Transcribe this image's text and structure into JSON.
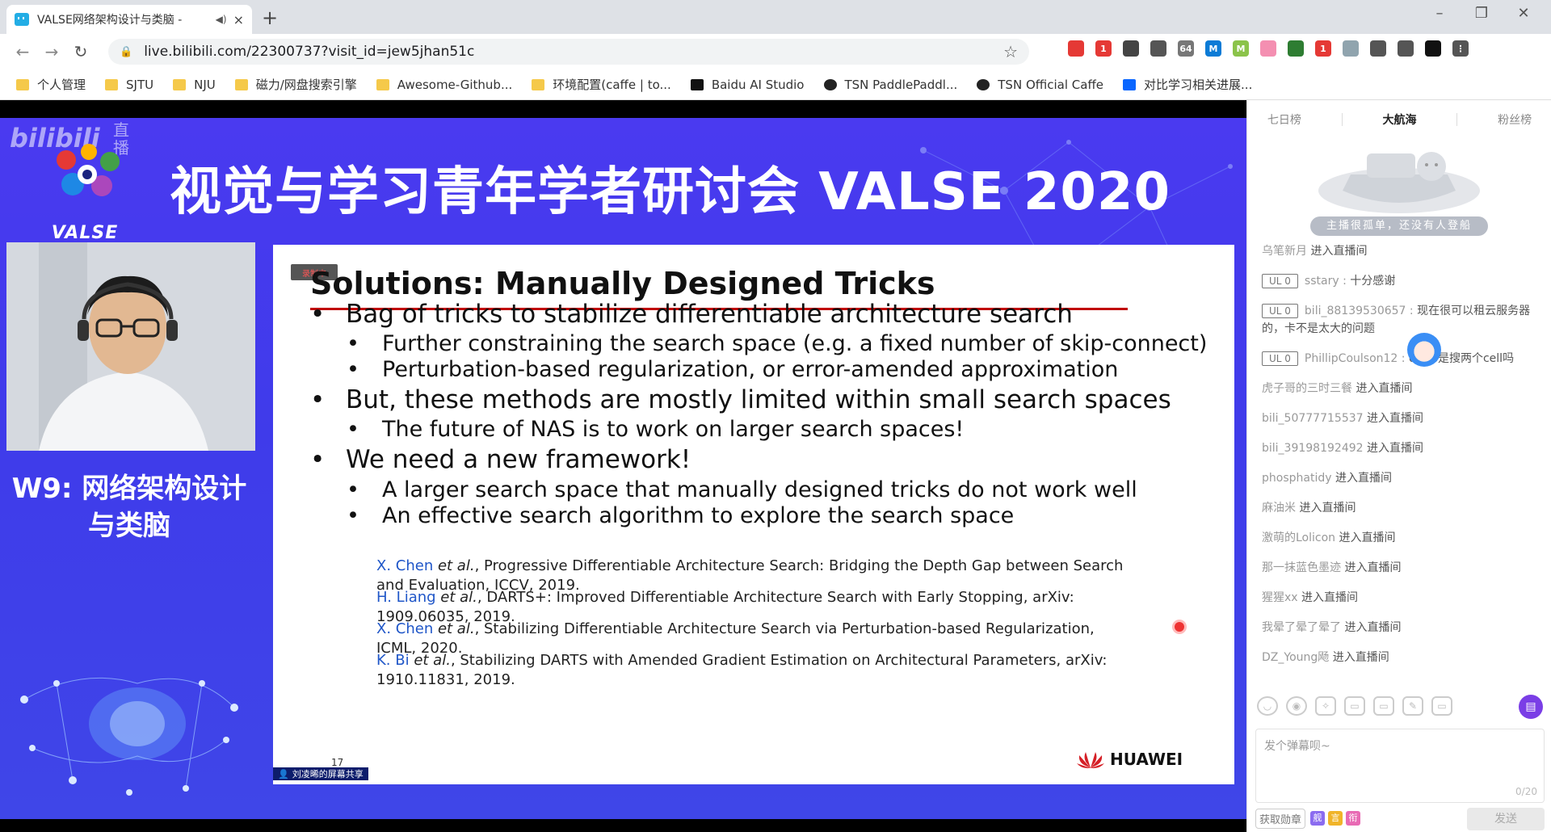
{
  "browser": {
    "tab_title": "VALSE网络架构设计与类脑 -",
    "tab_close": "×",
    "new_tab": "+",
    "url": "live.bilibili.com/22300737?visit_id=jew5jhan51c",
    "window_controls": {
      "minimize": "–",
      "maximize": "❐",
      "close": "✕"
    },
    "extensions": [
      {
        "name": "bili-ext-icon",
        "color": "#e53935",
        "label": ""
      },
      {
        "name": "ext-red-badge-icon",
        "color": "#e53935",
        "label": "1"
      },
      {
        "name": "download-icon",
        "color": "#444444",
        "label": ""
      },
      {
        "name": "code-icon",
        "color": "#555555",
        "label": ""
      },
      {
        "name": "base64-icon",
        "color": "#777777",
        "label": "64"
      },
      {
        "name": "m-blue-icon",
        "color": "#0b7bd6",
        "label": "M"
      },
      {
        "name": "m-green-icon",
        "color": "#8bc34a",
        "label": "M"
      },
      {
        "name": "pink-ext-icon",
        "color": "#f48fb1",
        "label": ""
      },
      {
        "name": "color-picker-icon",
        "color": "#2e7d32",
        "label": ""
      },
      {
        "name": "y-ext-icon",
        "color": "#e53935",
        "label": "1"
      },
      {
        "name": "bird-icon",
        "color": "#90a4ae",
        "label": ""
      },
      {
        "name": "puzzle-icon",
        "color": "#555555",
        "label": ""
      },
      {
        "name": "playlist-icon",
        "color": "#555555",
        "label": ""
      },
      {
        "name": "profile-avatar-icon",
        "color": "#111111",
        "label": ""
      },
      {
        "name": "menu-dots-icon",
        "color": "#555555",
        "label": "⋮"
      }
    ],
    "bookmarks": [
      {
        "label": "个人管理",
        "icon": "folder"
      },
      {
        "label": "SJTU",
        "icon": "folder"
      },
      {
        "label": "NJU",
        "icon": "folder"
      },
      {
        "label": "磁力/网盘搜索引擎",
        "icon": "folder"
      },
      {
        "label": "Awesome-Github...",
        "icon": "folder"
      },
      {
        "label": "环境配置(caffe | to...",
        "icon": "folder"
      },
      {
        "label": "Baidu AI Studio",
        "icon": "ai"
      },
      {
        "label": "TSN PaddlePaddl...",
        "icon": "gh"
      },
      {
        "label": "TSN Official Caffe",
        "icon": "gh"
      },
      {
        "label": "对比学习相关进展...",
        "icon": "zh"
      }
    ]
  },
  "stream": {
    "live_watermark": "bilibili",
    "live_watermark_side": "直播",
    "headline": "视觉与学习青年学者研讨会 VALSE 2020",
    "logo_text": "VALSE",
    "session_title_line1": "W9: 网络架构设计",
    "session_title_line2": "与类脑",
    "share_label": "刘凌晞的屏幕共享",
    "slide": {
      "recording_badge": "录制中",
      "title": "Solutions: Manually Designed Tricks",
      "bullets": [
        {
          "level": 1,
          "text": "Bag of tricks to stabilize differentiable architecture search"
        },
        {
          "level": 2,
          "text": "Further constraining the search space (e.g. a fixed number of skip-connect)"
        },
        {
          "level": 2,
          "text": "Perturbation-based regularization, or error-amended approximation"
        },
        {
          "level": 1,
          "text": "But, these methods are mostly limited within small search spaces"
        },
        {
          "level": 2,
          "text": "The future of NAS is to work on larger search spaces!"
        },
        {
          "level": 1,
          "text": "We need a new framework!"
        },
        {
          "level": 2,
          "text": "A larger search space that manually designed tricks do not work well"
        },
        {
          "level": 2,
          "text": "An effective search algorithm to explore the search space"
        }
      ],
      "references": [
        {
          "author": "X. Chen",
          "etal": " et al.",
          "line1": ", Progressive Differentiable Architecture Search: Bridging the Depth Gap between Search",
          "line2": "and Evaluation, ICCV, 2019."
        },
        {
          "author": "H. Liang",
          "etal": " et al.",
          "line1": ", DARTS+: Improved Differentiable Architecture Search with Early Stopping, arXiv:",
          "line2": "1909.06035, 2019."
        },
        {
          "author": "X. Chen",
          "etal": " et al.",
          "line1": ", Stabilizing Differentiable Architecture Search via Perturbation-based Regularization,",
          "line2": "ICML, 2020."
        },
        {
          "author": "K. Bi",
          "etal": " et al.",
          "line1": ", Stabilizing DARTS with Amended Gradient Estimation on Architectural Parameters, arXiv:",
          "line2": "1910.11831, 2019."
        }
      ],
      "page_number": "17",
      "brand": "HUAWEI"
    }
  },
  "sidebar": {
    "tabs": [
      "七日榜",
      "大航海",
      "粉丝榜"
    ],
    "active_tab": "大航海",
    "empty_banner": "主播很孤单，还没有人登船",
    "messages": [
      {
        "user": "乌笔新月",
        "badge": "",
        "sep": " ",
        "text": "进入直播间"
      },
      {
        "user": "sstary",
        "badge": "UL 0",
        "sep": " : ",
        "text": "十分感谢"
      },
      {
        "user": "bili_88139530657",
        "badge": "UL 0",
        "sep": " : ",
        "text": "现在很可以租云服务器的，卡不是太大的问题"
      },
      {
        "user": "PhillipCoulson12",
        "badge": "UL 0",
        "sep": " : ",
        "text": "darts是搜两个cell吗"
      },
      {
        "user": "虎子哥的三时三餐",
        "badge": "",
        "sep": " ",
        "text": "进入直播间"
      },
      {
        "user": "bili_50777715537",
        "badge": "",
        "sep": " ",
        "text": "进入直播间"
      },
      {
        "user": "bili_39198192492",
        "badge": "",
        "sep": " ",
        "text": "进入直播间"
      },
      {
        "user": "phosphatidy",
        "badge": "",
        "sep": " ",
        "text": "进入直播间"
      },
      {
        "user": "麻油米",
        "badge": "",
        "sep": " ",
        "text": "进入直播间"
      },
      {
        "user": "激萌的Lolicon",
        "badge": "",
        "sep": " ",
        "text": "进入直播间"
      },
      {
        "user": "那一抹蓝色墨迹",
        "badge": "",
        "sep": " ",
        "text": "进入直播间"
      },
      {
        "user": "猩猩xx",
        "badge": "",
        "sep": " ",
        "text": "进入直播间"
      },
      {
        "user": "我晕了晕了晕了",
        "badge": "",
        "sep": " ",
        "text": "进入直播间"
      },
      {
        "user": "DZ_Young飏",
        "badge": "",
        "sep": " ",
        "text": "进入直播间"
      }
    ],
    "input_placeholder": "发个弹幕呗~",
    "char_count": "0/20",
    "medal_label": "获取勋章",
    "badges": [
      {
        "text": "舰",
        "color": "#8b6cf0"
      },
      {
        "text": "言",
        "color": "#f0b429"
      },
      {
        "text": "衔",
        "color": "#e86ab4"
      }
    ],
    "send_label": "发送"
  }
}
